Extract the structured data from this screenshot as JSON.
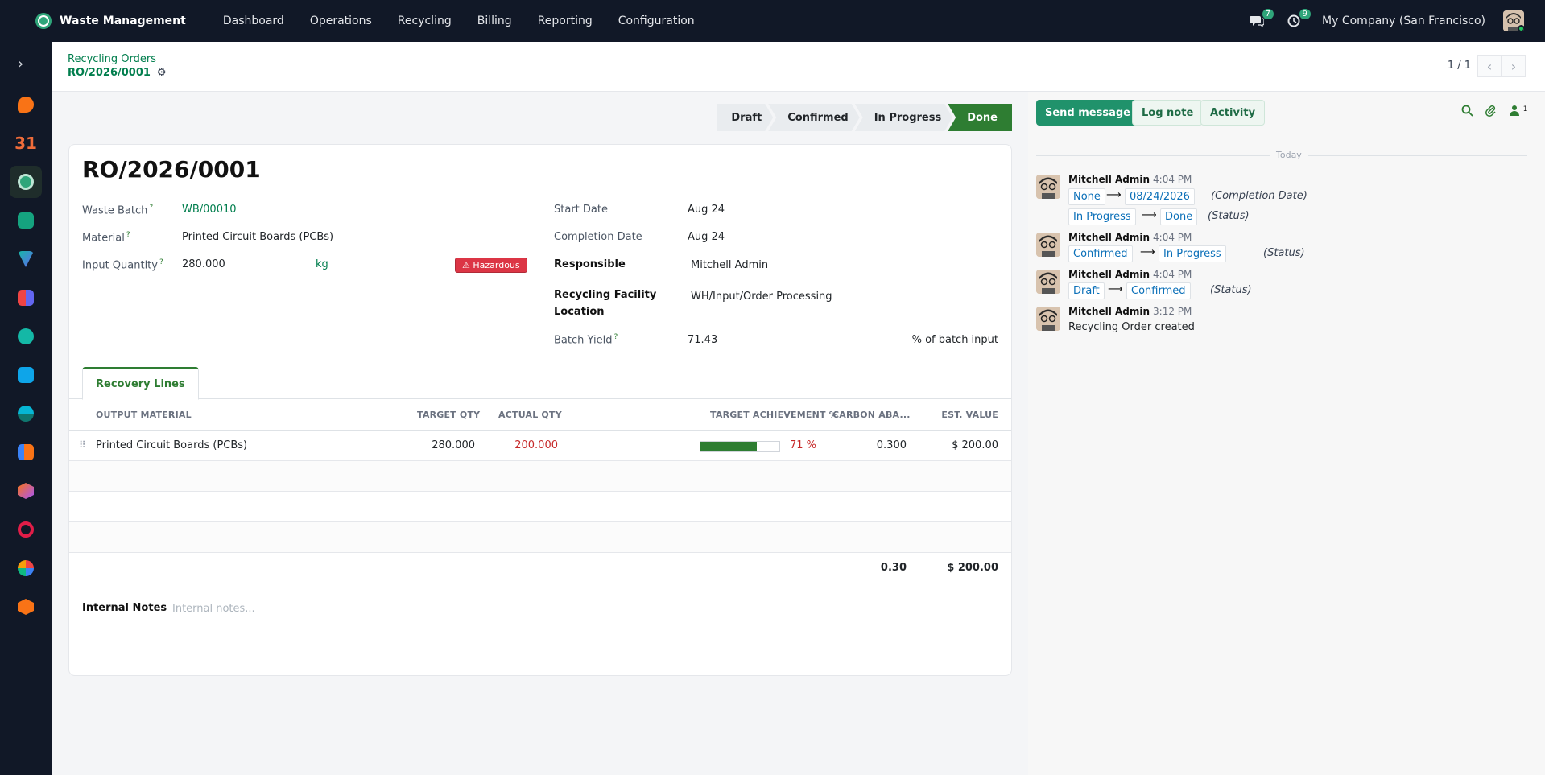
{
  "topbar": {
    "app_name": "Waste Management",
    "nav": [
      "Dashboard",
      "Operations",
      "Recycling",
      "Billing",
      "Reporting",
      "Configuration"
    ],
    "messages_badge": "7",
    "activities_badge": "9",
    "company": "My Company (San Francisco)"
  },
  "control": {
    "breadcrumb_parent": "Recycling Orders",
    "breadcrumb_current": "RO/2026/0001",
    "pager": "1 / 1"
  },
  "status": {
    "steps": [
      "Draft",
      "Confirmed",
      "In Progress",
      "Done"
    ],
    "current": "Done"
  },
  "form": {
    "title": "RO/2026/0001",
    "waste_batch_label": "Waste Batch",
    "waste_batch": "WB/00010",
    "material_label": "Material",
    "material": "Printed Circuit Boards (PCBs)",
    "input_qty_label": "Input Quantity",
    "input_qty": "280.000",
    "input_uom": "kg",
    "hazard_badge": "⚠ Hazardous",
    "start_date_label": "Start Date",
    "start_date": "Aug 24",
    "completion_date_label": "Completion Date",
    "completion_date": "Aug 24",
    "responsible_label": "Responsible",
    "responsible": "Mitchell Admin",
    "facility_label_1": "Recycling Facility",
    "facility_label_2": "Location",
    "facility": "WH/Input/Order Processing",
    "yield_label": "Batch Yield",
    "yield": "71.43",
    "yield_suffix": "% of batch input",
    "help_mark": "?"
  },
  "tabs": {
    "recovery": "Recovery Lines"
  },
  "table": {
    "headers": {
      "output_material": "OUTPUT MATERIAL",
      "target_qty": "TARGET QTY",
      "actual_qty": "ACTUAL QTY",
      "achievement": "TARGET ACHIEVEMENT %",
      "carbon": "CARBON ABA...",
      "est_value": "EST. VALUE"
    },
    "rows": [
      {
        "output_material": "Printed Circuit Boards (PCBs)",
        "target_qty": "280.000",
        "actual_qty": "200.000",
        "achievement_pct": 71,
        "achievement_label": "71 %",
        "carbon": "0.300",
        "est_value": "$ 200.00"
      }
    ],
    "totals": {
      "carbon": "0.30",
      "est_value": "$ 200.00"
    }
  },
  "notes": {
    "label": "Internal Notes",
    "placeholder": "Internal notes..."
  },
  "chatter": {
    "send_message": "Send message",
    "log_note": "Log note",
    "activity": "Activity",
    "followers_count": "1",
    "today": "Today",
    "messages": [
      {
        "author": "Mitchell Admin",
        "time": "4:04 PM",
        "changes": [
          {
            "from": "None",
            "to": "08/24/2026",
            "field": "(Completion Date)"
          },
          {
            "from": "In Progress",
            "to": "Done",
            "field": "(Status)"
          }
        ]
      },
      {
        "author": "Mitchell Admin",
        "time": "4:04 PM",
        "changes": [
          {
            "from": "Confirmed",
            "to": "In Progress",
            "field": "(Status)"
          }
        ]
      },
      {
        "author": "Mitchell Admin",
        "time": "4:04 PM",
        "changes": [
          {
            "from": "Draft",
            "to": "Confirmed",
            "field": "(Status)"
          }
        ]
      },
      {
        "author": "Mitchell Admin",
        "time": "3:12 PM",
        "body": "Recycling Order created"
      }
    ],
    "arrow": "⟶"
  },
  "colors": {
    "brand": "#017e4d",
    "done": "#2e7d32",
    "primary_btn": "#20926b",
    "hazard": "#dc3545"
  }
}
